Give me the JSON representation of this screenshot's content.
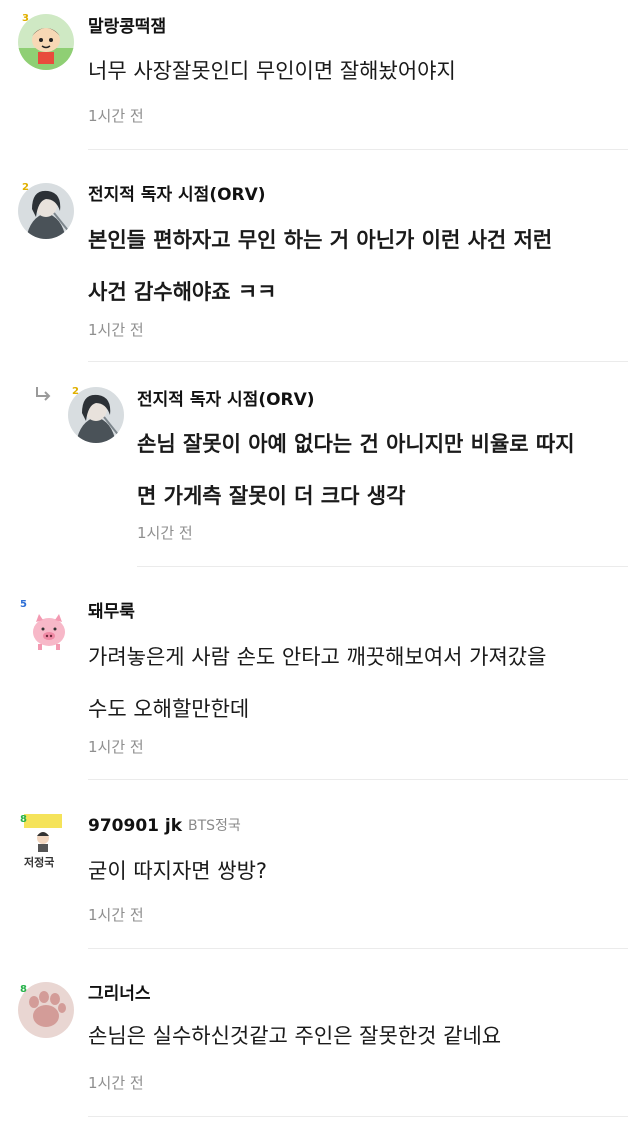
{
  "comments": [
    {
      "nickname": "말랑콩떡잼",
      "lines": [
        "너무 사장잘못인디 무인이면 잘해놨어야지"
      ],
      "time": "1시간 전",
      "level": "3",
      "avatar_icon": "cartoon-boy-avatar"
    },
    {
      "nickname": "전지적 독자 시점(ORV)",
      "lines": [
        "본인들 편하자고 무인 하는 거 아닌가 이런 사건 저런",
        "사건 감수해야죠 ㅋㅋ"
      ],
      "time": "1시간 전",
      "level": "2",
      "avatar_icon": "anime-character-avatar"
    },
    {
      "nickname": "전지적 독자 시점(ORV)",
      "lines": [
        "손님 잘못이 아예 없다는 건 아니지만 비율로 따지",
        "면 가게측 잘못이 더 크다 생각"
      ],
      "time": "1시간 전",
      "level": "2",
      "is_reply": true,
      "avatar_icon": "anime-character-avatar"
    },
    {
      "nickname": "돼무룩",
      "lines": [
        "가려놓은게 사람 손도 안타고 깨끗해보여서 가져갔을",
        "수도 오해할만한데"
      ],
      "time": "1시간 전",
      "level": "5",
      "avatar_icon": "pig-avatar"
    },
    {
      "nickname": "970901 jk",
      "tag": "BTS정국",
      "lines": [
        "굳이 따지자면 쌍방?"
      ],
      "time": "1시간 전",
      "level": "8",
      "avatar_text": "저정국",
      "avatar_icon": "fan-badge-avatar"
    },
    {
      "nickname": "그리너스",
      "lines": [
        "손님은 실수하신것같고 주인은 잘못한것 같네요"
      ],
      "time": "1시간 전",
      "level": "8",
      "avatar_icon": "cat-paw-avatar"
    }
  ],
  "colors": {
    "level_green": "#27b24a",
    "level_yellow": "#e0b000",
    "level_blue": "#2f6fd6",
    "divider": "#ebebeb"
  }
}
